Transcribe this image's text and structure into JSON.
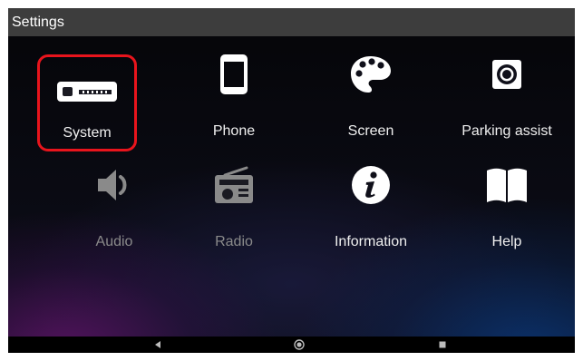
{
  "header": {
    "title": "Settings"
  },
  "tiles": [
    {
      "label": "System",
      "icon": "car-stereo-icon",
      "selected": true,
      "enabled": true
    },
    {
      "label": "Phone",
      "icon": "phone-icon",
      "selected": false,
      "enabled": true
    },
    {
      "label": "Screen",
      "icon": "palette-icon",
      "selected": false,
      "enabled": true
    },
    {
      "label": "Parking assist",
      "icon": "camera-icon",
      "selected": false,
      "enabled": true
    },
    {
      "label": "Audio",
      "icon": "speaker-icon",
      "selected": false,
      "enabled": false
    },
    {
      "label": "Radio",
      "icon": "radio-icon",
      "selected": false,
      "enabled": false
    },
    {
      "label": "Information",
      "icon": "info-icon",
      "selected": false,
      "enabled": true
    },
    {
      "label": "Help",
      "icon": "book-icon",
      "selected": false,
      "enabled": true
    }
  ],
  "nav": {
    "back_icon": "back-triangle-icon",
    "home_icon": "home-circle-icon",
    "recent_icon": "recent-square-icon"
  },
  "colors": {
    "title_bar": "#3d3d3d",
    "selection_border": "#e8141c",
    "enabled_text": "#f0f0f0",
    "disabled_text": "#8a8a8a"
  }
}
